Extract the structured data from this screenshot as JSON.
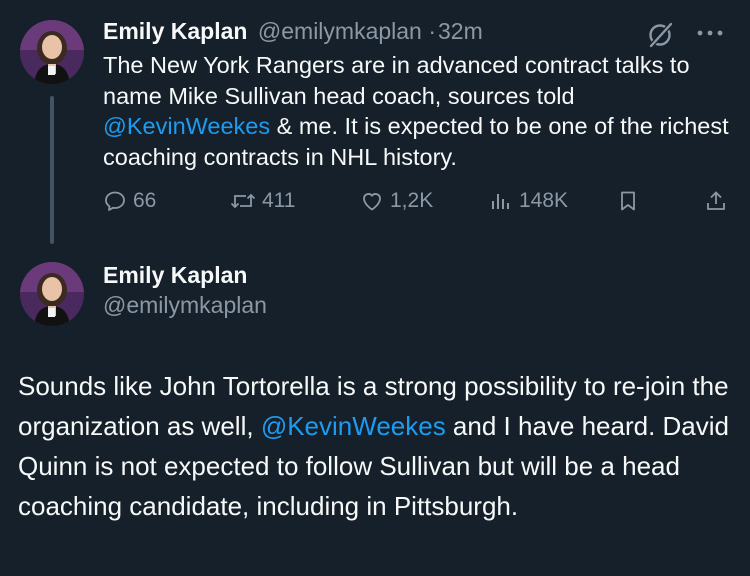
{
  "tweet1": {
    "author_name": "Emily Kaplan",
    "author_handle": "@emilymkaplan",
    "separator": "·",
    "time": "32m",
    "text": {
      "part1": "The New York Rangers are in advanced contract talks to name Mike Sullivan head coach, sources told ",
      "mention": "@KevinWeekes",
      "part2": " & me. It is expected to be one of the richest coaching contracts in NHL history."
    },
    "actions": {
      "replies": "66",
      "reposts": "411",
      "likes": "1,2K",
      "views": "148K"
    },
    "icons": [
      "grok-icon",
      "more-icon",
      "reply-icon",
      "repost-icon",
      "like-icon",
      "views-icon",
      "bookmark-icon",
      "share-icon"
    ]
  },
  "tweet2": {
    "author_name": "Emily Kaplan",
    "author_handle": "@emilymkaplan",
    "text": {
      "part1": "Sounds like John Tortorella is a strong possibility to re-join the organization as well, ",
      "mention": "@KevinWeekes",
      "part2": " and I have heard. David Quinn is not expected to follow Sullivan but will be a head coaching candidate, including in Pittsburgh."
    }
  },
  "colors": {
    "background": "#15202b",
    "text": "#f7f9f9",
    "secondary": "#8b98a5",
    "accent": "#1d9bf0",
    "thread_line": "#425364"
  }
}
